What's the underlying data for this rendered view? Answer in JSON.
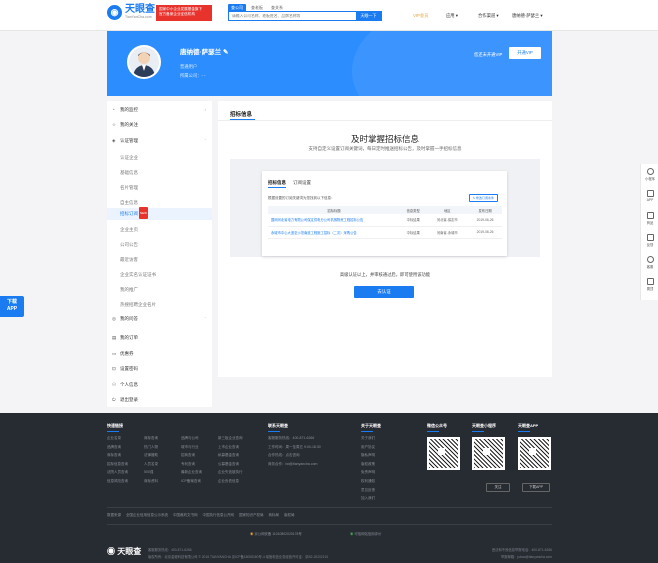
{
  "header": {
    "logo_text": "天眼查",
    "logo_sub": "TianYanCha.com",
    "promo_line1": "国家中小企业发展基金旗下",
    "promo_line2": "官方备案企业征信机构",
    "search_tabs": [
      "查公司",
      "查老板",
      "查关系"
    ],
    "search_placeholder": "请输入公司名称、老板姓名、品牌名称等",
    "search_button": "天眼一下",
    "vip_label": "VIP会员",
    "nav": [
      "应用 ▾",
      "合作渠道 ▾",
      "唐纳德·萨瑟兰 ▾"
    ]
  },
  "profile": {
    "name": "唐纳德·萨瑟兰",
    "role": "普通用户",
    "company": "所属公司：- -",
    "not_vip": "您还未开通VIP",
    "open_vip": "开通VIP"
  },
  "sidebar": {
    "top_items": [
      "我的监控",
      "我的关注",
      "认证管理"
    ],
    "sub_items": [
      "认证企业",
      "基础信息",
      "名片管理",
      "自主信息",
      "招标订阅",
      "企业主页",
      "公司公告",
      "最近访客",
      "企业实名认证证书",
      "我的推广",
      "热搜招聘企业名片"
    ],
    "hot_badge": "NEW",
    "bottom_items": [
      "我的问答",
      "我的订单",
      "优惠券",
      "设置密码",
      "个人信息",
      "退出登录"
    ]
  },
  "main": {
    "section_title": "招标信息",
    "headline": "及时掌握招标信息",
    "subline": "支持自定义设置订阅关键词，每日定时推送招标公告，及时掌握一手招标信息",
    "preview": {
      "tabs": [
        "招标信息",
        "订阅设置"
      ],
      "message": "根据设置的订阅关键词为您找到以下信息：",
      "edit_button": "✎ 修改订阅条件",
      "columns": [
        "招标标题",
        "信息类型",
        "地区",
        "发布日期"
      ],
      "rows": [
        [
          "国网河北省电力有限公司保定供电分公司机械物资工程招标公告",
          "中标结果",
          "河北省-保定市",
          "2019-06-26"
        ],
        [
          "永城市中心大道至沙坦南道工程施工招标（二次）采购公告",
          "中标结果",
          "河南省-永城市",
          "2019-06-26"
        ]
      ]
    },
    "condition": "高级认证以上，并审核通过后，即可使用该功能",
    "open_button": "去认证"
  },
  "right_bar": [
    "小程序",
    "APP",
    "商品",
    "反馈",
    "客服",
    "置顶"
  ],
  "download_tab": [
    "下载",
    "APP"
  ],
  "footer": {
    "col1_title": "快速链接",
    "col1_links": [
      [
        "企业名录",
        "商标查询",
        "品牌与公司",
        "新三板企业查询"
      ],
      [
        "品牌查询",
        "热门人物",
        "城市与行业",
        "上市企业查询"
      ],
      [
        "商标查询",
        "法律援助",
        "招商查询",
        "私募基金查询"
      ],
      [
        "招标信息查询",
        "人员名录",
        "专利查询",
        "公募基金查询"
      ],
      [
        "法院人员查询",
        "500强",
        "最新企业查询",
        "企业失信被执行"
      ],
      [
        "信息风险查询",
        "商标资料",
        "ICP备案查询",
        "企业负债信息"
      ]
    ],
    "col2_title": "联系天眼查",
    "col2_lines": [
      "客服服务热线：400-871-6266",
      "工作时间：周一至周五 9:00-18:30",
      "合作热线：点击咨询",
      "商务合作：bd@tianyancha.com"
    ],
    "col3_title": "关于天眼查",
    "col3_links": [
      "关于我们",
      "用户协议",
      "隐私声明",
      "版权政策",
      "免责声明",
      "权利通知",
      "意见反馈",
      "加入我们"
    ],
    "qr_titles": [
      "微信公众号",
      "天眼查小程序",
      "天眼查APP"
    ],
    "qr_buttons": [
      "关注",
      "下载APP"
    ],
    "bottom_links": [
      "数据来源",
      "全国企业信用信息公示系统",
      "中国裁判文书网",
      "中国执行信息公开网",
      "国家知识产权局",
      "商标局",
      "版权局"
    ],
    "beian1": "京公网安备 11010802020178号",
    "beian2": "可信网站信用评价",
    "copy1": "客服服务热线：400-871-6266",
    "copy2": "版权所有：北京金堤科技有限公司 © 2018 TIANYANCHA 京ICP备18008180号-4 增值电信业务经营许可证：京B2-20202191",
    "right1": "违法和不良信息举报电话：400-871-6266",
    "right2": "举报邮箱：jubao@tianyancha.com"
  }
}
